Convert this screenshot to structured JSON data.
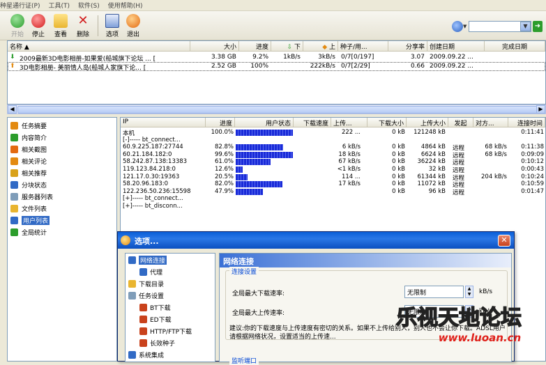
{
  "menu": {
    "items": [
      "种星通行证(P)",
      "工具(T)",
      "软件(S)",
      "使用帮助(H)"
    ]
  },
  "toolbar": {
    "buttons": [
      {
        "label": "开始",
        "icon": "play-icon"
      },
      {
        "label": "停止",
        "icon": "stop-icon"
      },
      {
        "label": "查看",
        "icon": "folder-icon"
      },
      {
        "label": "删除",
        "icon": "delete-icon"
      },
      {
        "label": "选项",
        "icon": "options-icon"
      },
      {
        "label": "退出",
        "icon": "exit-icon"
      }
    ]
  },
  "colors": {
    "selection": "#316ac5",
    "titlebar": "#0a5fd8",
    "progress": "#1a2bd8",
    "window_bg": "#ece9d8"
  },
  "torrents": {
    "headers": [
      "名称 ▲",
      "大小",
      "进度",
      "下",
      "上",
      "种子/用...",
      "分享率",
      "创建日期",
      "完成日期"
    ],
    "rows": [
      {
        "name": "2009最新3D电影相册-如果爱(船城旗下论坛 ...  [",
        "size": "3.38 GB",
        "progress": "9.2%",
        "down": "1kB/s",
        "up": "3kB/s",
        "seeds": "0/7[0/197]",
        "ratio": "3.07",
        "created": "2009.09.22 ...",
        "completed": "",
        "status": "downloading"
      },
      {
        "name": "3D电影相册- 美丽情人岛(船城人家旗下论...  [",
        "size": "2.52 GB",
        "progress": "100%",
        "down": "",
        "up": "222kB/s",
        "seeds": "0/7[2/29]",
        "ratio": "0.66",
        "created": "2009.09.22 ...",
        "completed": "",
        "status": "seeding"
      }
    ]
  },
  "sidebar": {
    "items": [
      {
        "label": "任务摘要",
        "icon": "summary-icon"
      },
      {
        "label": "内容简介",
        "icon": "content-icon"
      },
      {
        "label": "相关截图",
        "icon": "screenshot-icon"
      },
      {
        "label": "相关评论",
        "icon": "comment-icon"
      },
      {
        "label": "相关推荐",
        "icon": "recommend-icon"
      },
      {
        "label": "分块状态",
        "icon": "pieces-icon"
      },
      {
        "label": "服务器列表",
        "icon": "server-icon"
      },
      {
        "label": "文件列表",
        "icon": "files-icon"
      },
      {
        "label": "用户列表",
        "icon": "users-icon",
        "selected": true
      },
      {
        "label": "全局统计",
        "icon": "stats-icon"
      }
    ]
  },
  "peers": {
    "headers": [
      "IP",
      "进度",
      "用户状态",
      "下载速度",
      "上传...",
      "下载大小",
      "上传大小",
      "发起",
      "对方...",
      "连接时间"
    ],
    "rows": [
      {
        "ip": "本机",
        "progress": "100.0%",
        "bar": 1.0,
        "down": "",
        "up": "222 ...",
        "dsize": "0 kB",
        "usize": "121248 kB",
        "init": "",
        "remote": "",
        "time": "0:11:41"
      },
      {
        "ip": "[-]----- bt_connect...",
        "progress": "",
        "bar": null,
        "down": "",
        "up": "",
        "dsize": "",
        "usize": "",
        "init": "",
        "remote": "",
        "time": ""
      },
      {
        "ip": "60.9.225.187:27744",
        "progress": "82.8%",
        "bar": 0.828,
        "down": "",
        "up": "6 kB/s",
        "dsize": "0 kB",
        "usize": "4864 kB",
        "init": "远程",
        "remote": "68 kB/s",
        "time": "0:11:38"
      },
      {
        "ip": "60.21.184.182:0",
        "progress": "99.6%",
        "bar": 0.996,
        "down": "",
        "up": "18 kB/s",
        "dsize": "0 kB",
        "usize": "6624 kB",
        "init": "远程",
        "remote": "68 kB/s",
        "time": "0:09:09"
      },
      {
        "ip": "58.242.87.138:13383",
        "progress": "61.0%",
        "bar": 0.61,
        "down": "",
        "up": "67 kB/s",
        "dsize": "0 kB",
        "usize": "36224 kB",
        "init": "远程",
        "remote": "",
        "time": "0:10:12"
      },
      {
        "ip": "119.123.84.218:0",
        "progress": "12.6%",
        "bar": 0.126,
        "down": "",
        "up": "<1 kB/s",
        "dsize": "0 kB",
        "usize": "32 kB",
        "init": "远程",
        "remote": "",
        "time": "0:00:43"
      },
      {
        "ip": "121.17.0.30:19363",
        "progress": "20.5%",
        "bar": 0.205,
        "down": "",
        "up": "114 ...",
        "dsize": "0 kB",
        "usize": "61344 kB",
        "init": "远程",
        "remote": "204 kB/s",
        "time": "0:10:24"
      },
      {
        "ip": "58.20.96.183:0",
        "progress": "82.0%",
        "bar": 0.82,
        "down": "",
        "up": "17 kB/s",
        "dsize": "0 kB",
        "usize": "11072 kB",
        "init": "远程",
        "remote": "",
        "time": "0:10:59"
      },
      {
        "ip": "122.236.50.236:15598",
        "progress": "47.9%",
        "bar": 0.479,
        "down": "",
        "up": "",
        "dsize": "0 kB",
        "usize": "96 kB",
        "init": "远程",
        "remote": "",
        "time": "0:01:47"
      },
      {
        "ip": "[+]----- bt_connect...",
        "progress": "",
        "bar": null,
        "down": "",
        "up": "",
        "dsize": "",
        "usize": "",
        "init": "",
        "remote": "",
        "time": ""
      },
      {
        "ip": "[+]----- bt_disconn...",
        "progress": "",
        "bar": null,
        "down": "",
        "up": "",
        "dsize": "",
        "usize": "",
        "init": "",
        "remote": "",
        "time": ""
      }
    ]
  },
  "dialog": {
    "title": "选项...",
    "close": "✕",
    "tree": [
      {
        "label": "网络连接",
        "icon": "network-icon",
        "selected": true
      },
      {
        "label": "代理",
        "icon": "proxy-icon"
      },
      {
        "label": "下载目录",
        "icon": "folder-icon"
      },
      {
        "label": "任务设置",
        "icon": "task-icon"
      },
      {
        "label": "BT下载",
        "icon": "bt-icon"
      },
      {
        "label": "ED下载",
        "icon": "ed-icon"
      },
      {
        "label": "HTTP/FTP下载",
        "icon": "http-icon"
      },
      {
        "label": "长效种子",
        "icon": "seed-icon"
      },
      {
        "label": "系统集成",
        "icon": "system-icon"
      }
    ],
    "pane_title": "网络连接",
    "group_label": "连接设置",
    "max_download_label": "全局最大下载速率:",
    "max_download_value": "无限制",
    "max_upload_label": "全局最大上传速率:",
    "max_upload_value": "无限制",
    "unit": "kB/s",
    "advice": "建议:你的下载速度与上传速度有密切的关系。如果不上传给别人，别人也不会让你下载。ADSL用户请根据网络状况，设置适当的上传速...",
    "group2_label": "监听端口"
  },
  "watermark": {
    "text": "乐视天地论坛",
    "url": "www.luoan.cn"
  }
}
